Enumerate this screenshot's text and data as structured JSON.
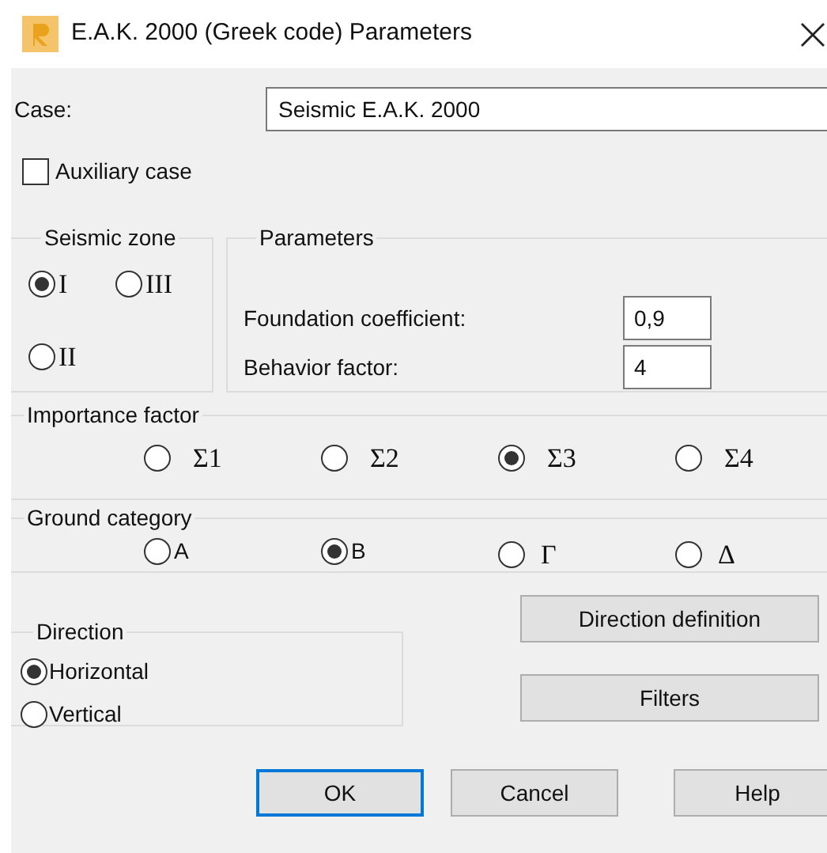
{
  "window": {
    "title": "E.A.K. 2000 (Greek code) Parameters"
  },
  "case": {
    "label": "Case:",
    "value": "Seismic E.A.K. 2000"
  },
  "auxiliary": {
    "label": "Auxiliary case",
    "checked": false
  },
  "seismic_zone": {
    "title": "Seismic zone",
    "options": [
      {
        "label": "I",
        "selected": true
      },
      {
        "label": "III",
        "selected": false
      },
      {
        "label": "II",
        "selected": false
      }
    ]
  },
  "parameters": {
    "title": "Parameters",
    "fields": [
      {
        "label": "Foundation coefficient:",
        "value": "0,9"
      },
      {
        "label": "Behavior factor:",
        "value": "4"
      }
    ]
  },
  "importance_factor": {
    "title": "Importance factor",
    "options": [
      {
        "label": "Σ1",
        "selected": false
      },
      {
        "label": "Σ2",
        "selected": false
      },
      {
        "label": "Σ3",
        "selected": true
      },
      {
        "label": "Σ4",
        "selected": false
      }
    ]
  },
  "ground_category": {
    "title": "Ground category",
    "options": [
      {
        "label": "A",
        "selected": false,
        "serif": false
      },
      {
        "label": "B",
        "selected": true,
        "serif": false
      },
      {
        "label": "Γ",
        "selected": false,
        "serif": true
      },
      {
        "label": "Δ",
        "selected": false,
        "serif": true
      }
    ]
  },
  "direction": {
    "title": "Direction",
    "options": [
      {
        "label": "Horizontal",
        "selected": true
      },
      {
        "label": "Vertical",
        "selected": false
      }
    ]
  },
  "side_buttons": [
    "Direction definition",
    "Filters"
  ],
  "buttons": [
    {
      "label": "OK",
      "default": true
    },
    {
      "label": "Cancel",
      "default": false
    },
    {
      "label": "Help",
      "default": false
    }
  ]
}
